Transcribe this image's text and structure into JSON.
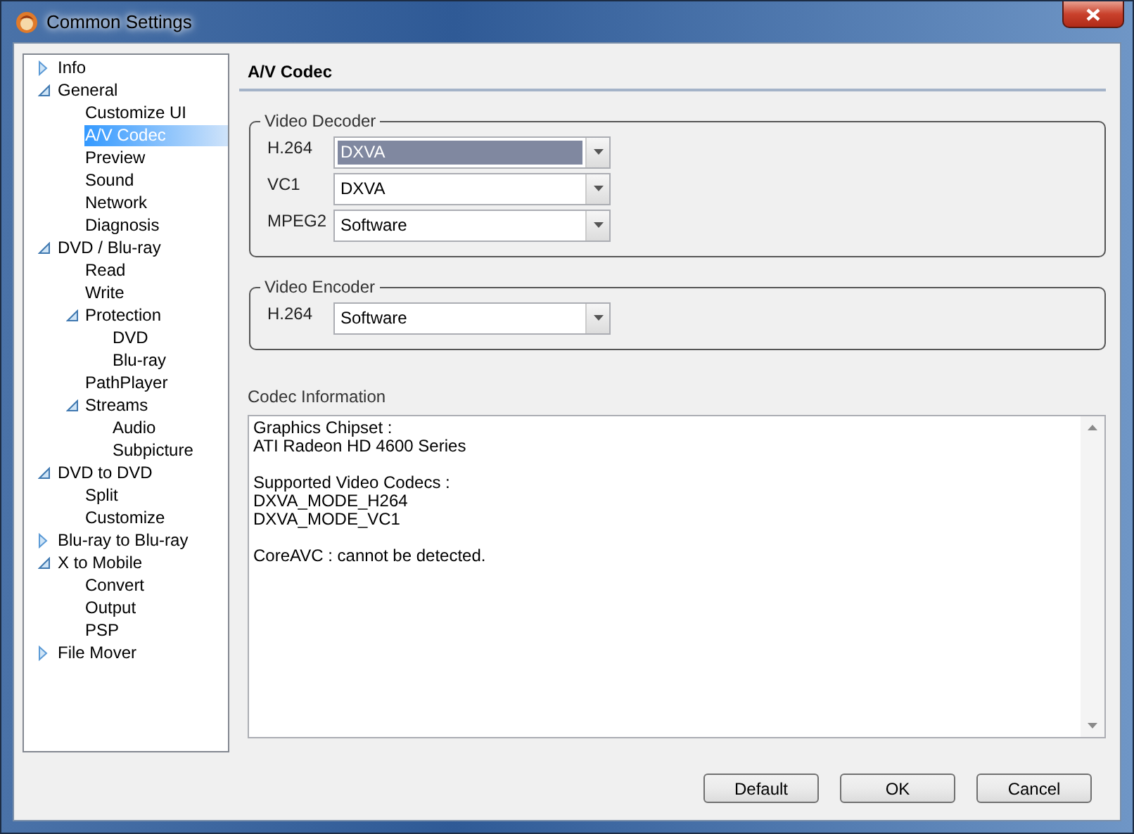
{
  "window": {
    "title": "Common Settings"
  },
  "tree": {
    "items": [
      {
        "label": "Info",
        "expanded": false,
        "selected": false
      },
      {
        "label": "General",
        "expanded": true,
        "selected": false,
        "children": [
          {
            "label": "Customize UI",
            "selected": false
          },
          {
            "label": "A/V Codec",
            "selected": true
          },
          {
            "label": "Preview",
            "selected": false
          },
          {
            "label": "Sound",
            "selected": false
          },
          {
            "label": "Network",
            "selected": false
          },
          {
            "label": "Diagnosis",
            "selected": false
          }
        ]
      },
      {
        "label": "DVD / Blu-ray",
        "expanded": true,
        "selected": false,
        "children": [
          {
            "label": "Read",
            "selected": false
          },
          {
            "label": "Write",
            "selected": false
          },
          {
            "label": "Protection",
            "expanded": true,
            "selected": false,
            "children": [
              {
                "label": "DVD",
                "selected": false
              },
              {
                "label": "Blu-ray",
                "selected": false
              }
            ]
          },
          {
            "label": "PathPlayer",
            "selected": false
          },
          {
            "label": "Streams",
            "expanded": true,
            "selected": false,
            "children": [
              {
                "label": "Audio",
                "selected": false
              },
              {
                "label": "Subpicture",
                "selected": false
              }
            ]
          }
        ]
      },
      {
        "label": "DVD to DVD",
        "expanded": true,
        "selected": false,
        "children": [
          {
            "label": "Split",
            "selected": false
          },
          {
            "label": "Customize",
            "selected": false
          }
        ]
      },
      {
        "label": "Blu-ray to Blu-ray",
        "expanded": false,
        "selected": false
      },
      {
        "label": "X to Mobile",
        "expanded": true,
        "selected": false,
        "children": [
          {
            "label": "Convert",
            "selected": false
          },
          {
            "label": "Output",
            "selected": false
          },
          {
            "label": "PSP",
            "selected": false
          }
        ]
      },
      {
        "label": "File Mover",
        "expanded": false,
        "selected": false
      }
    ]
  },
  "panel": {
    "title": "A/V Codec",
    "groups": [
      {
        "title": "Video Decoder",
        "rows": [
          {
            "label": "H.264",
            "value": "DXVA",
            "focused": true
          },
          {
            "label": "VC1",
            "value": "DXVA",
            "focused": false
          },
          {
            "label": "MPEG2",
            "value": "Software",
            "focused": false
          }
        ]
      },
      {
        "title": "Video Encoder",
        "rows": [
          {
            "label": "H.264",
            "value": "Software",
            "focused": false
          }
        ]
      }
    ],
    "info": {
      "label": "Codec Information",
      "paragraphs": [
        [
          "Graphics Chipset :",
          "ATI Radeon HD 4600 Series"
        ],
        [
          "Supported Video Codecs :",
          "DXVA_MODE_H264",
          "DXVA_MODE_VC1"
        ],
        [
          "CoreAVC : cannot be detected."
        ]
      ]
    }
  },
  "buttons": [
    "Default",
    "OK",
    "Cancel"
  ]
}
